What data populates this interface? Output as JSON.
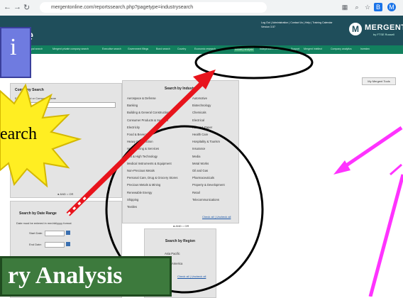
{
  "browser": {
    "url": "mergentonline.com/reportssearch.php?pagetype=industrysearch"
  },
  "header": {
    "logo_text": "MERGENT",
    "logo_sub": "by FTSE Russell",
    "logo_partial": "e",
    "top_links": "Log Out | Administration | Contact Us | Help | Training Calendar",
    "version": "Version 3.57",
    "nav_links": [
      "pal search",
      "Mergent private company search",
      "Executive search",
      "Government filings",
      "Bond search",
      "Country",
      "Economic research",
      "Industry analysis",
      "Independent research",
      "Support",
      "Mergent Intellect",
      "Company analytics",
      "Investex"
    ]
  },
  "my_tools": "My Mergent Tools",
  "company_search": {
    "title": "Company Search",
    "label": "Enter symbol or Company Name",
    "and_or": "● AND  ○ OR"
  },
  "date_range": {
    "title": "Search by Date Range",
    "note": "Date must be entered in mm/dd/yyyy format",
    "start_label": "Start Date:",
    "end_label": "End Date:"
  },
  "industry": {
    "title": "Search by Industry",
    "left": [
      "Aerospace & Defense",
      "Banking",
      "Building & General Construction",
      "Consumer Products & Services",
      "Electricity",
      "Food & Beverage",
      "Heavy Construction",
      "Hotel, Dining & Services",
      "Info & High Technology",
      "Medical Instruments & Equipment",
      "Non-Precious Metals",
      "Personal Care, Drug & Grocery Stores",
      "Precious Metals & Mining",
      "Renewable Energy",
      "Shipping",
      "Textiles"
    ],
    "right": [
      "Automotive",
      "Biotechnology",
      "Chemicals",
      "Electrical",
      "Forest & Paper",
      "Health Care",
      "Hospitality & Tourism",
      "Insurance",
      "Media",
      "Metal Works",
      "Oil and Gas",
      "Pharmaceuticals",
      "Property & Development",
      "Retail",
      "Telecommunications"
    ],
    "check_all": "Check all | Uncheck all",
    "and_or": "● AND  ○ OR"
  },
  "region": {
    "title": "Search by Region",
    "items": [
      "Asia Pacific",
      "Latin America"
    ],
    "check_all": "Check all | Uncheck all"
  },
  "annotations": {
    "blue_button_glyph": "i",
    "callout_text": "earch",
    "banner_text": "ry Analysis"
  },
  "colors": {
    "header_bg": "#1f4e5b",
    "nav_bar": "#12805e",
    "arrow": "#e8141c",
    "magenta": "#ff33ff",
    "callout": "#ffee22",
    "banner": "#3d7a3d"
  }
}
